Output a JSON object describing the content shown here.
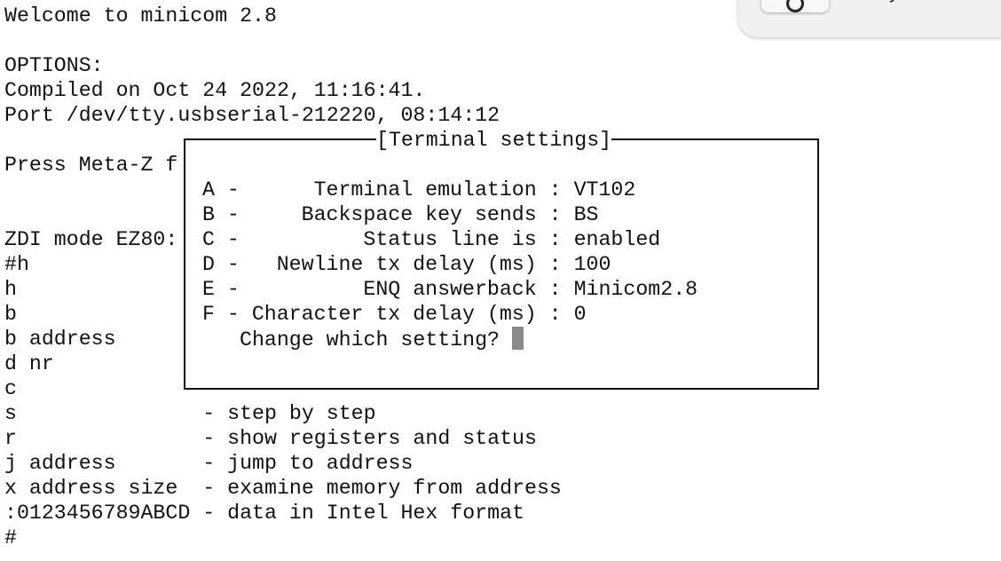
{
  "terminal": {
    "lines": [
      "Welcome to minicom 2.8",
      "",
      "OPTIONS:",
      "Compiled on Oct 24 2022, 11:16:41.",
      "Port /dev/tty.usbserial-212220, 08:14:12",
      "",
      "Press Meta-Z f",
      "",
      "",
      "ZDI mode EZ80:",
      "#h",
      "h",
      "b",
      "b address",
      "d nr",
      "c",
      "s               - step by step",
      "r               - show registers and status",
      "j address       - jump to address",
      "x address size  - examine memory from address",
      ":0123456789ABCD - data in Intel Hex format",
      "#"
    ]
  },
  "dialog": {
    "title": "[Terminal settings]",
    "settings": [
      {
        "key": "A",
        "label": "     Terminal emulation",
        "value": "VT102"
      },
      {
        "key": "B",
        "label": "    Backspace key sends",
        "value": "BS"
      },
      {
        "key": "C",
        "label": "         Status line is",
        "value": "enabled"
      },
      {
        "key": "D",
        "label": "  Newline tx delay (ms)",
        "value": "100"
      },
      {
        "key": "E",
        "label": "         ENQ answerback",
        "value": "Minicom2.8"
      },
      {
        "key": "F",
        "label": "Character tx delay (ms)",
        "value": "0"
      }
    ],
    "prompt": "Change which setting? "
  },
  "notification": {
    "text": "ready",
    "button_icon": "refresh-icon"
  }
}
